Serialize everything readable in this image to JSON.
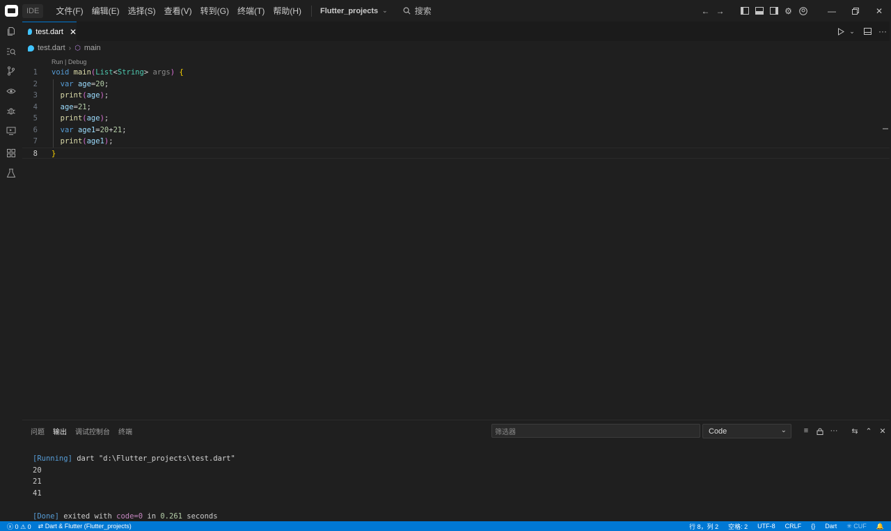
{
  "titlebar": {
    "ide_badge": "IDE",
    "menu": [
      "文件(F)",
      "编辑(E)",
      "选择(S)",
      "查看(V)",
      "转到(G)",
      "终端(T)",
      "帮助(H)"
    ],
    "project": "Flutter_projects",
    "search": "搜索"
  },
  "editor": {
    "tab_label": "test.dart",
    "breadcrumb": {
      "file": "test.dart",
      "symbol": "main"
    },
    "codelens": "Run | Debug",
    "lines": [
      {
        "n": "1"
      },
      {
        "n": "2"
      },
      {
        "n": "3"
      },
      {
        "n": "4"
      },
      {
        "n": "5"
      },
      {
        "n": "6"
      },
      {
        "n": "7"
      },
      {
        "n": "8"
      }
    ]
  },
  "panel": {
    "tabs": [
      "问题",
      "输出",
      "调试控制台",
      "终端"
    ],
    "active_tab": "输出",
    "filter_placeholder": "筛选器",
    "channel": "Code",
    "output": {
      "running_tag": "[Running]",
      "running_cmd": " dart \"d:\\Flutter_projects\\test.dart\"",
      "results": [
        "20",
        "21",
        "41"
      ],
      "done_tag": "[Done]",
      "done_text1": " exited with ",
      "done_code": "code=0",
      "done_text2": " in ",
      "done_time": "0.261",
      "done_text3": " seconds"
    }
  },
  "statusbar": {
    "errors": "0",
    "warnings": "0",
    "remote": "Dart & Flutter (Flutter_projects)",
    "position": "行 8，列 2",
    "spaces": "空格: 2",
    "encoding": "UTF-8",
    "eol": "CRLF",
    "braces": "{}",
    "language": "Dart",
    "extra": "CUF"
  },
  "colors": {
    "accent": "#0078d4",
    "background": "#1f1f1f"
  }
}
